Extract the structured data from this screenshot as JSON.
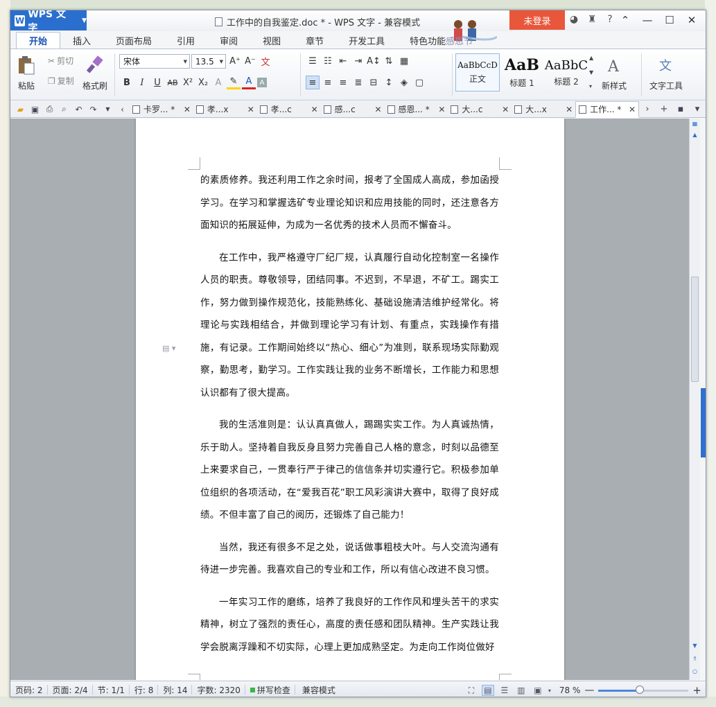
{
  "app": {
    "name": "WPS 文字",
    "window_title": "工作中的自我鉴定.doc * - WPS 文字 - 兼容模式",
    "login_label": "未登录",
    "help_label": "?"
  },
  "ribbon_tabs": [
    {
      "label": "开始",
      "active": true
    },
    {
      "label": "插入"
    },
    {
      "label": "页面布局"
    },
    {
      "label": "引用"
    },
    {
      "label": "审阅"
    },
    {
      "label": "视图"
    },
    {
      "label": "章节"
    },
    {
      "label": "开发工具"
    },
    {
      "label": "特色功能"
    },
    {
      "label": "感恩节"
    }
  ],
  "ribbon": {
    "paste_label": "粘贴",
    "cut_label": "剪切",
    "copy_label": "复制",
    "format_painter_label": "格式刷",
    "font_name": "宋体",
    "font_size": "13.5",
    "styles": [
      {
        "preview": "AaBbCcD",
        "label": "正文"
      },
      {
        "preview": "AaB",
        "label": "标题 1"
      },
      {
        "preview": "AaBbC",
        "label": "标题 2"
      }
    ],
    "new_style_label": "新样式",
    "text_tools_label": "文字工具"
  },
  "doc_tabs": [
    {
      "label": "卡罗... *"
    },
    {
      "label": "孝...x"
    },
    {
      "label": "孝...c"
    },
    {
      "label": "感...c"
    },
    {
      "label": "感恩... *"
    },
    {
      "label": "大...c"
    },
    {
      "label": "大...x"
    },
    {
      "label": "工作... *",
      "active": true
    }
  ],
  "document": {
    "paragraphs": [
      "的素质修养。我还利用工作之余时间，报考了全国成人高成，参加函授学习。在学习和掌握选矿专业理论知识和应用技能的同时，还注意各方面知识的拓展延伸，为成为一名优秀的技术人员而不懈奋斗。",
      "在工作中，我严格遵守厂纪厂规，认真履行自动化控制室一名操作人员的职责。尊敬领导，团结同事。不迟到，不早退，不矿工。踢实工作，努力做到操作规范化，技能熟练化、基础设施清洁维护经常化。将理论与实践相结合，并做到理论学习有计划、有重点，实践操作有措施，有记录。工作期间始终以“热心、细心”为准则，联系现场实际勤观察，勤思考，勤学习。工作实践让我的业务不断增长，工作能力和思想认识都有了很大提高。",
      "我的生活准则是：认认真真做人，踢踢实实工作。为人真诚热情，乐于助人。坚持着自我反身且努力完善自己人格的意念，时刻以品德至上来要求自己，一贯奉行严于律己的信信条并切实遵行它。积极参加单位组织的各项活动，在“爱我百花”职工风彩演讲大赛中，取得了良好成绩。不但丰富了自己的阅历，还锻炼了自己能力！",
      "当然，我还有很多不足之处，说话做事粗枝大叶。与人交流沟通有待进一步完善。我喜欢自己的专业和工作，所以有信心改进不良习惯。",
      "一年实习工作的磨练，培养了我良好的工作作风和埋头苦干的求实精神，树立了强烈的责任心，高度的责任感和团队精神。生产实践让我学会脱离浮躁和不切实际，心理上更加成熟坚定。为走向工作岗位做好"
    ]
  },
  "status": {
    "page_num": "页码: 2",
    "pages": "页面: 2/4",
    "section": "节: 1/1",
    "row": "行: 8",
    "col": "列: 14",
    "word_count": "字数: 2320",
    "spell_check": "拼写检查",
    "compat_mode": "兼容模式",
    "zoom": "78 %",
    "zoom_level": 0.46
  }
}
